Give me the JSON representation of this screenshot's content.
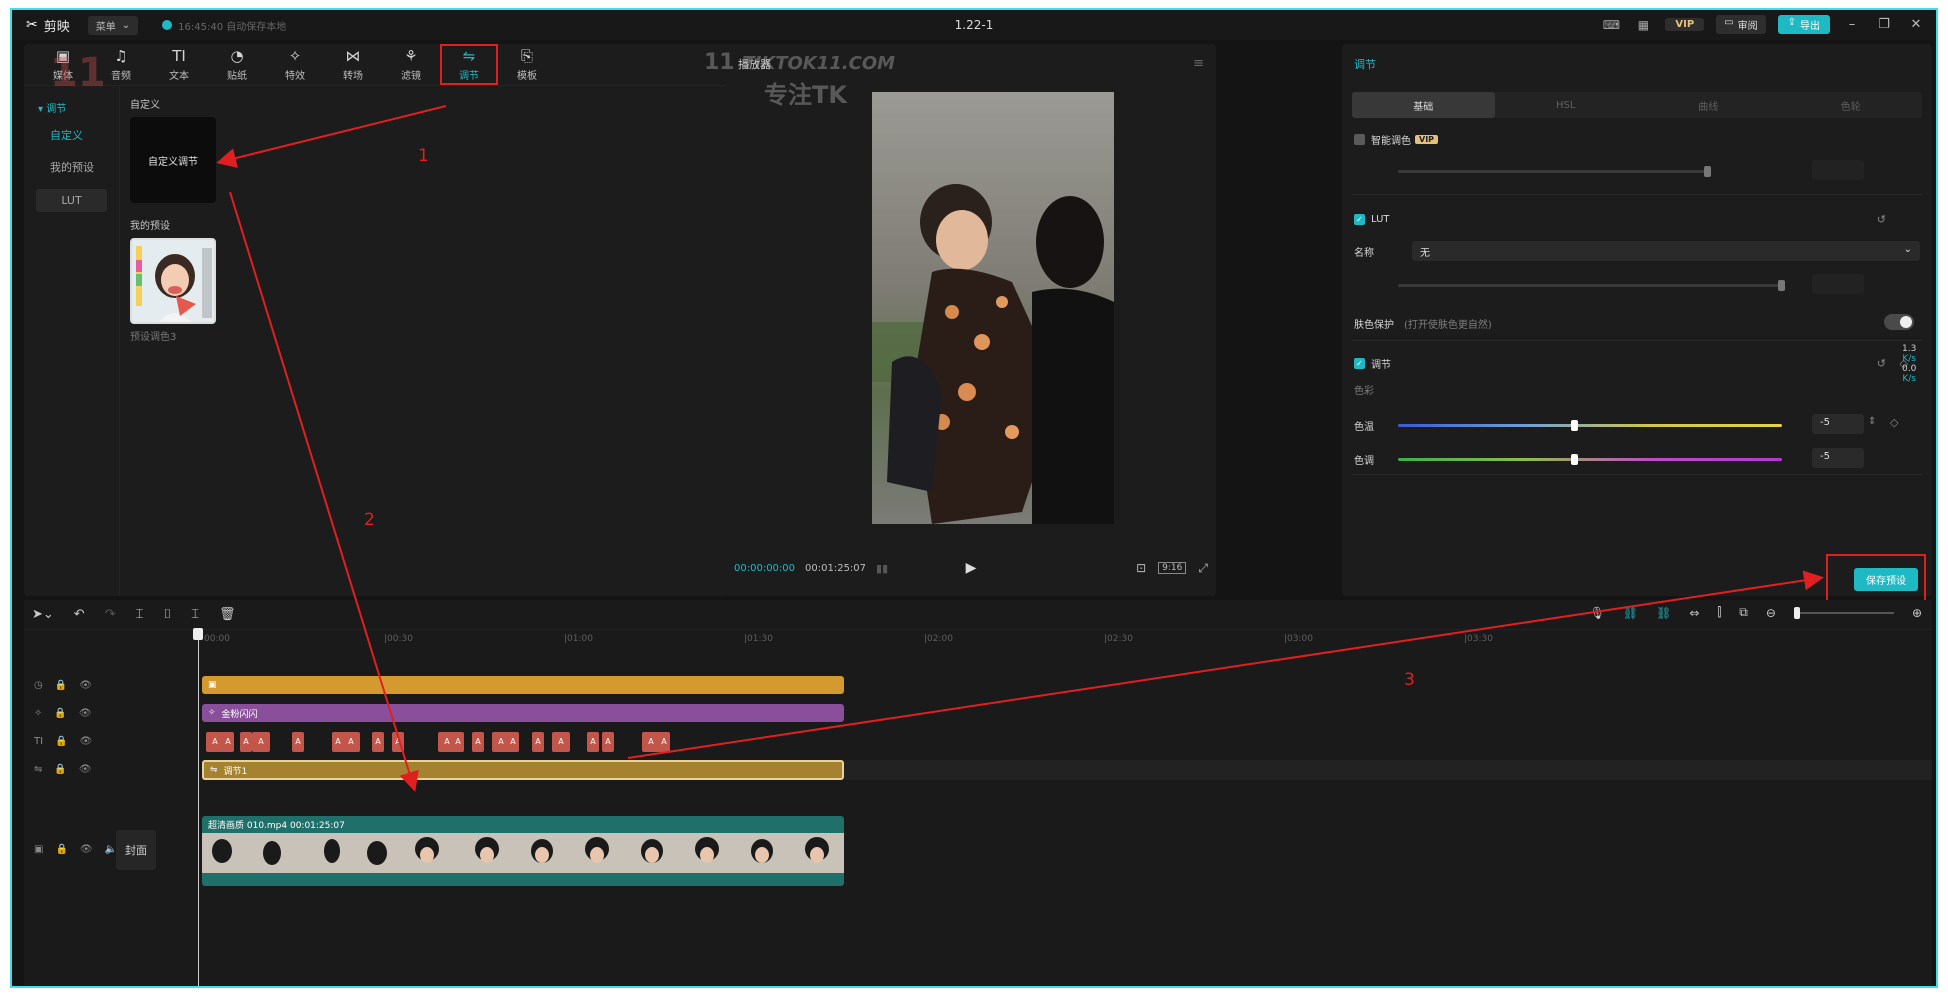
{
  "titlebar": {
    "app_name": "剪映",
    "menu_label": "菜单",
    "save_status": "16:45:40 自动保存本地",
    "title": "1.22-1",
    "vip_label": "VIP",
    "review_label": "审阅",
    "export_label": "导出"
  },
  "watermark": {
    "text": "TIKTOK11.COM",
    "sub": "专注TK",
    "logo": "11"
  },
  "toolbar": {
    "items": [
      {
        "label": "媒体",
        "icon": "media-icon"
      },
      {
        "label": "音频",
        "icon": "audio-icon"
      },
      {
        "label": "文本",
        "icon": "text-icon"
      },
      {
        "label": "贴纸",
        "icon": "sticker-icon"
      },
      {
        "label": "特效",
        "icon": "effects-icon"
      },
      {
        "label": "转场",
        "icon": "transition-icon"
      },
      {
        "label": "滤镜",
        "icon": "filter-icon"
      },
      {
        "label": "调节",
        "icon": "adjust-icon"
      },
      {
        "label": "模板",
        "icon": "template-icon"
      }
    ],
    "active_index": 7
  },
  "side_nav": {
    "header": "▾ 调节",
    "items": [
      "自定义",
      "我的预设",
      "LUT"
    ]
  },
  "left_content": {
    "custom_label": "自定义",
    "custom_card": "自定义调节",
    "preset_label": "我的预设",
    "preset_name": "预设调色3"
  },
  "player": {
    "title": "播放器",
    "current_time": "00:00:00:00",
    "total_time": "00:01:25:07",
    "ratio": "9:16"
  },
  "adjust_panel": {
    "title": "调节",
    "tabs": [
      "基础",
      "HSL",
      "曲线",
      "色轮"
    ],
    "active_tab": 0,
    "smart_color": "智能调色",
    "vip_mini": "VIP",
    "lut_label": "LUT",
    "name_label": "名称",
    "name_value": "无",
    "skin_protect": "肤色保护",
    "skin_hint": "(打开使肤色更自然)",
    "adjust_label": "调节",
    "color_section": "色彩",
    "temp_label": "色温",
    "temp_value": "-5",
    "tint_label": "色调",
    "tint_value": "-5",
    "save_preset": "保存预设",
    "side_readout_1": "1.3",
    "side_readout_unit_1": "K/s",
    "side_readout_2": "0.0",
    "side_readout_unit_2": "K/s"
  },
  "timeline": {
    "ruler": [
      "00:00",
      "|00:30",
      "|01:00",
      "|01:30",
      "|02:00",
      "|02:30",
      "|03:00",
      "|03:30"
    ],
    "cover_label": "封面",
    "sticker_clip": "金粉闪闪",
    "adjust_clip": "调节1",
    "video_clip": "超清画质  010.mp4  00:01:25:07",
    "text_segments": [
      "A",
      "A",
      "A",
      "A",
      "A",
      "A",
      "A",
      "A",
      "A",
      "A",
      "A",
      "A",
      "A",
      "A",
      "A",
      "A",
      "A",
      "A",
      "A",
      "A"
    ]
  },
  "annotations": [
    "1",
    "2",
    "3"
  ],
  "colors": {
    "accent": "#1fb9c4",
    "annotation": "#e02020",
    "sticker_clip": "#d49a30",
    "purple_clip": "#8a4f9a",
    "video_clip": "#1f6f6a"
  }
}
